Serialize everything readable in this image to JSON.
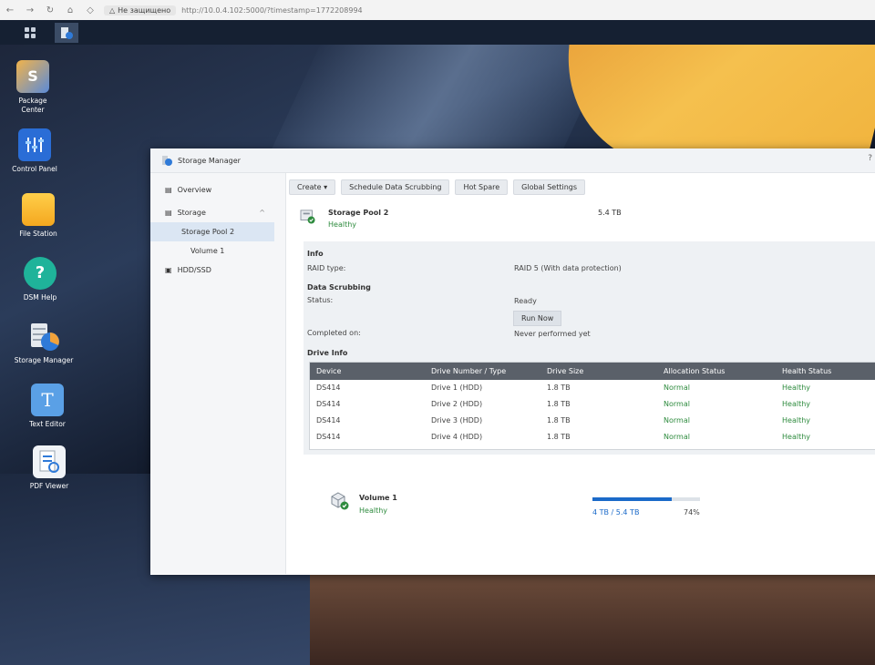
{
  "browser": {
    "security_label": "Не защищено",
    "url": "http://10.0.4.102:5000/?timestamp=1772208994"
  },
  "desktop": {
    "icons": [
      {
        "label_line1": "Package",
        "label_line2": "Center",
        "icon": "package-center-icon"
      },
      {
        "label_line1": "Control Panel",
        "label_line2": "",
        "icon": "control-panel-icon"
      },
      {
        "label_line1": "File Station",
        "label_line2": "",
        "icon": "file-station-icon"
      },
      {
        "label_line1": "DSM Help",
        "label_line2": "",
        "icon": "dsm-help-icon"
      },
      {
        "label_line1": "Storage Manager",
        "label_line2": "",
        "icon": "storage-manager-icon"
      },
      {
        "label_line1": "Text Editor",
        "label_line2": "",
        "icon": "text-editor-icon"
      },
      {
        "label_line1": "PDF Viewer",
        "label_line2": "",
        "icon": "pdf-viewer-icon"
      }
    ]
  },
  "window": {
    "title": "Storage Manager",
    "help": "?"
  },
  "sidebar": {
    "overview": "Overview",
    "storage": "Storage",
    "pool": "Storage Pool 2",
    "volume": "Volume 1",
    "hdd": "HDD/SSD"
  },
  "toolbar": {
    "create": "Create",
    "schedule": "Schedule Data Scrubbing",
    "hot_spare": "Hot Spare",
    "global": "Global Settings"
  },
  "pool": {
    "name": "Storage Pool 2",
    "status": "Healthy",
    "size": "5.4 TB"
  },
  "info": {
    "heading": "Info",
    "raid_label": "RAID type:",
    "raid_value": "RAID 5 (With data protection)",
    "scrub_heading": "Data Scrubbing",
    "status_label": "Status:",
    "status_value": "Ready",
    "run_now": "Run Now",
    "completed_label": "Completed on:",
    "completed_value": "Never performed yet",
    "drive_heading": "Drive Info"
  },
  "drives": {
    "columns": [
      "Device",
      "Drive Number / Type",
      "Drive Size",
      "Allocation Status",
      "Health Status"
    ],
    "rows": [
      [
        "DS414",
        "Drive 1 (HDD)",
        "1.8 TB",
        "Normal",
        "Healthy"
      ],
      [
        "DS414",
        "Drive 2 (HDD)",
        "1.8 TB",
        "Normal",
        "Healthy"
      ],
      [
        "DS414",
        "Drive 3 (HDD)",
        "1.8 TB",
        "Normal",
        "Healthy"
      ],
      [
        "DS414",
        "Drive 4 (HDD)",
        "1.8 TB",
        "Normal",
        "Healthy"
      ]
    ]
  },
  "volume": {
    "name": "Volume 1",
    "status": "Healthy",
    "usage": "4 TB / 5.4 TB",
    "percent_label": "74%",
    "percent_value": 0.74,
    "more": "..."
  },
  "colors": {
    "healthy": "#2e8b3e",
    "accent": "#1b6ac9",
    "table_header": "#5a6069"
  }
}
